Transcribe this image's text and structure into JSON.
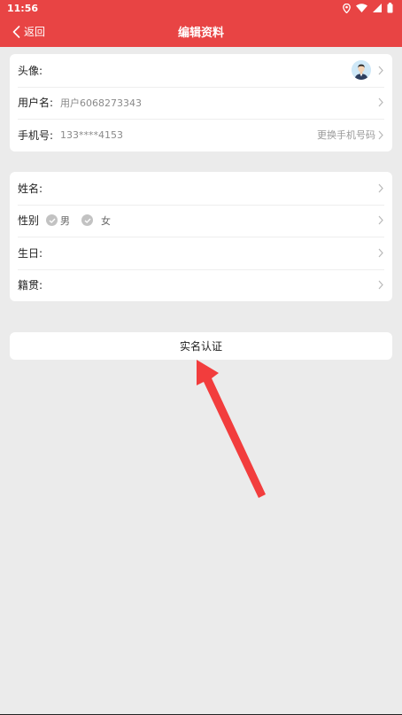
{
  "status_bar": {
    "time": "11:56"
  },
  "header": {
    "back_label": "返回",
    "title": "编辑资料"
  },
  "account_card": {
    "avatar_label": "头像:",
    "username_label": "用户名:",
    "username_value": "用户6068273343",
    "phone_label": "手机号:",
    "phone_value": "133****4153",
    "phone_action": "更换手机号码"
  },
  "profile_card": {
    "name_label": "姓名:",
    "gender_label": "性别",
    "gender_options": [
      "男",
      "女"
    ],
    "birthday_label": "生日:",
    "hometown_label": "籍贯:"
  },
  "verify_button_label": "实名认证",
  "colors": {
    "accent": "#e84444",
    "background": "#ebebeb",
    "annotation_arrow": "#f23d3d"
  }
}
